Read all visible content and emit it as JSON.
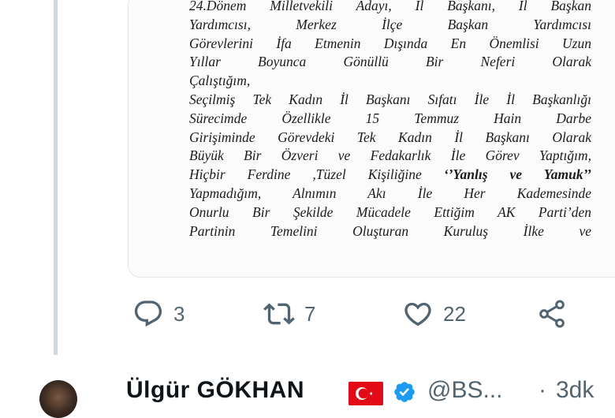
{
  "letter_lines": [
    "24.Dönem Milletvekili Adayı, İl Başkanı, İl Başkan",
    "Yardımcısı, Merkez İlçe Başkan Yardımcısı",
    "Görevlerini İfa Etmenin Dışında En Önemlisi Uzun",
    "Yıllar Boyunca Gönüllü Bir Neferi Olarak",
    "Çalıştığım,",
    "Seçilmiş Tek Kadın İl Başkanı Sıfatı İle İl Başkanlığı",
    "Sürecimde Özellikle 15 Temmuz Hain Darbe",
    "Girişiminde Görevdeki Tek Kadın İl Başkanı Olarak",
    "Büyük Bir Özveri ve Fedakarlık İle Görev Yaptığım,"
  ],
  "letter_line10": {
    "before": "Hiçbir Ferdine ,Tüzel Kişiliğine",
    "quoted": "‘’Yanlış ve Yamuk’’"
  },
  "letter_lines_after": [
    "Yapmadığım, Alnımın Akı İle Her Kademesinde",
    "Onurlu Bir Şekilde Mücadele Ettiğim AK Parti’den",
    "Partinin Temelini Oluşturan Kuruluş İlke ve"
  ],
  "actions": {
    "reply_count": "3",
    "retweet_count": "7",
    "like_count": "22"
  },
  "next_tweet": {
    "author_name": "Ülgür GÖKHAN",
    "handle": "@BS...",
    "separator": "·",
    "time": "3dk"
  },
  "icons": {
    "reply": "reply-icon",
    "retweet": "retweet-icon",
    "like": "heart-icon",
    "share": "share-icon",
    "flag": "turkey-flag-icon",
    "verified": "verified-badge-icon"
  },
  "colors": {
    "action_gray": "#536471",
    "verified_blue": "#1d9bf0",
    "flag_red": "#e30a17",
    "thread_line": "#cfd9de"
  }
}
